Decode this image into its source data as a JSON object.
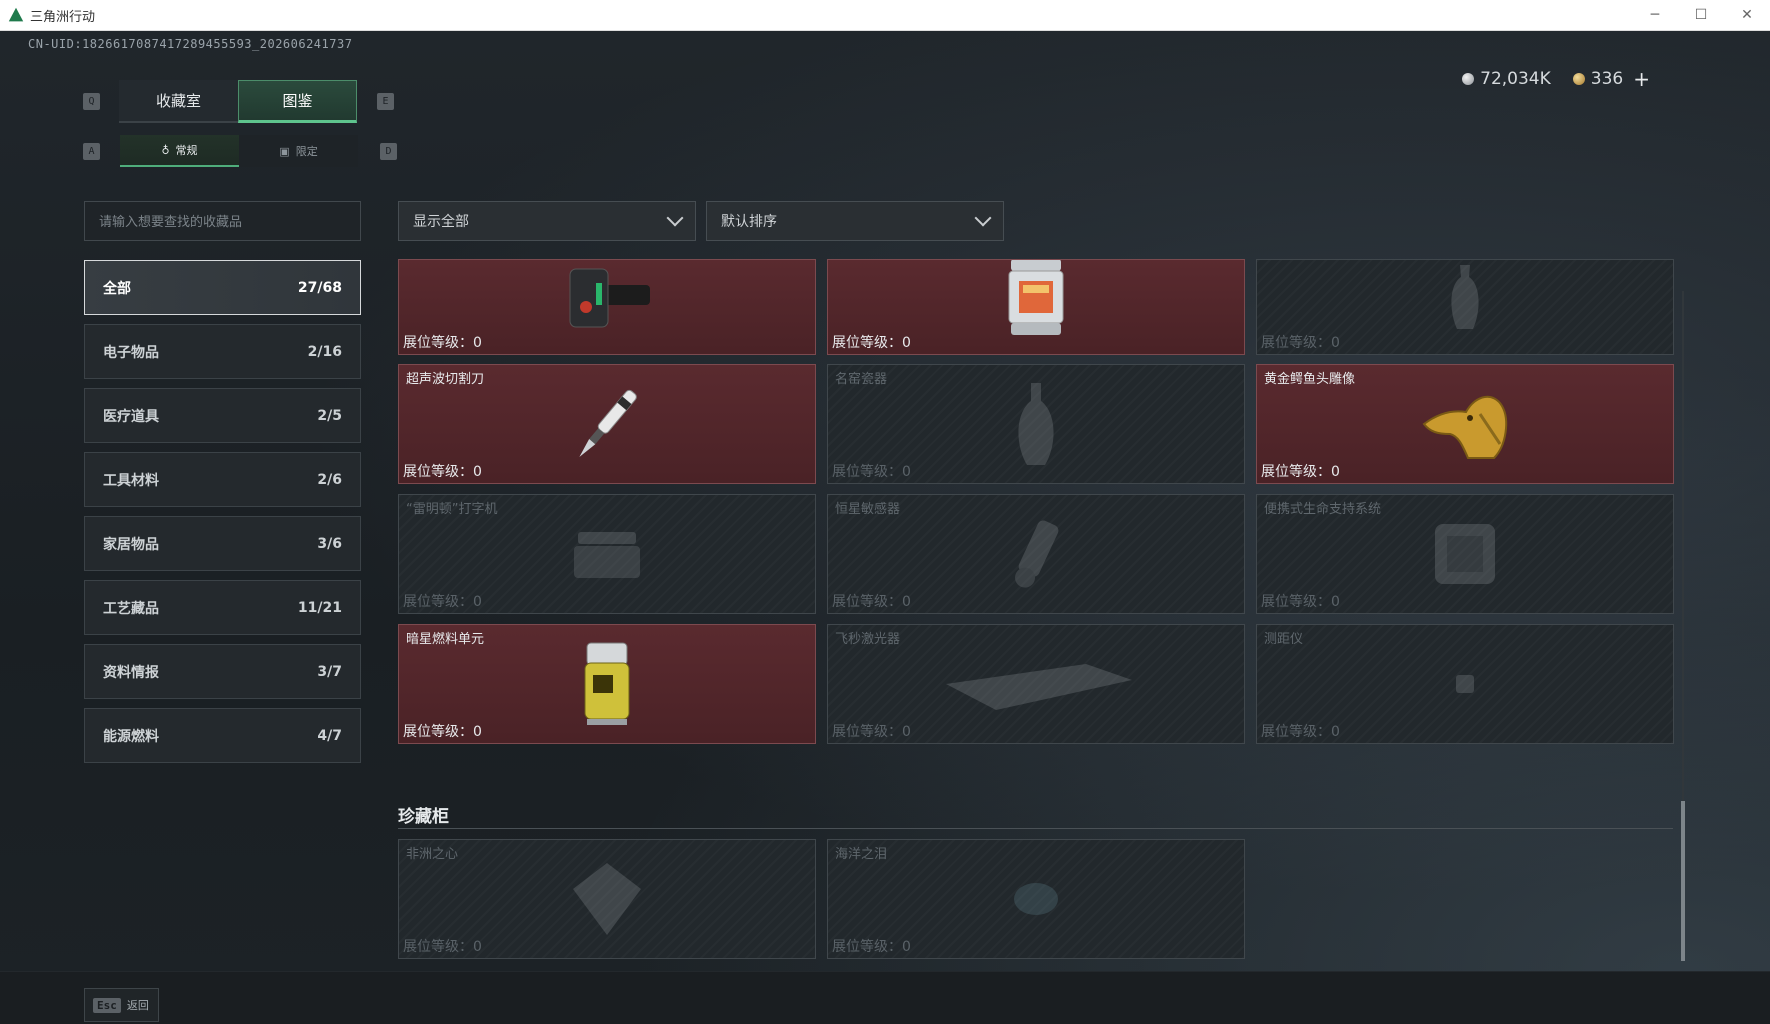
{
  "window": {
    "title": "三角洲行动",
    "minimize": "─",
    "maximize": "☐",
    "close": "✕"
  },
  "header": {
    "uid": "CN-UID:1826617087417289455593_202606241737",
    "currency": [
      {
        "icon": "silver-coin-icon",
        "value": "72,034K"
      },
      {
        "icon": "gold-coin-icon",
        "value": "336"
      }
    ],
    "plus_label": "+"
  },
  "tabs": {
    "prev_key": "Q",
    "next_key": "E",
    "main": [
      {
        "label": "收藏室",
        "active": false
      },
      {
        "label": "图鉴",
        "active": true
      }
    ],
    "sub_prev_key": "A",
    "sub_next_key": "D",
    "sub": [
      {
        "label": "常规",
        "active": true
      },
      {
        "label": "限定",
        "active": false
      }
    ]
  },
  "search": {
    "placeholder": "请输入想要查找的收藏品"
  },
  "categories": [
    {
      "label": "全部",
      "count": "27/68",
      "active": true
    },
    {
      "label": "电子物品",
      "count": "2/16"
    },
    {
      "label": "医疗道具",
      "count": "2/5"
    },
    {
      "label": "工具材料",
      "count": "2/6"
    },
    {
      "label": "家居物品",
      "count": "3/6"
    },
    {
      "label": "工艺藏品",
      "count": "11/21"
    },
    {
      "label": "资料情报",
      "count": "3/7"
    },
    {
      "label": "能源燃料",
      "count": "4/7"
    }
  ],
  "filters": {
    "show": "显示全部",
    "sort": "默认排序"
  },
  "level_label": "展位等级：0",
  "items": [
    {
      "name": "",
      "owned": true,
      "art": "wrist-device-icon"
    },
    {
      "name": "",
      "owned": true,
      "art": "lantern-icon"
    },
    {
      "name": "",
      "owned": false,
      "art": "vase-icon"
    },
    {
      "name": "超声波切割刀",
      "owned": true,
      "art": "cutter-knife-icon"
    },
    {
      "name": "名窑瓷器",
      "owned": false,
      "art": "porcelain-icon"
    },
    {
      "name": "黄金鳄鱼头雕像",
      "owned": true,
      "art": "gold-crocodile-icon"
    },
    {
      "name": "“雷明顿”打字机",
      "owned": false,
      "art": "typewriter-icon"
    },
    {
      "name": "恒星敏感器",
      "owned": false,
      "art": "sensor-icon"
    },
    {
      "name": "便携式生命支持系统",
      "owned": false,
      "art": "life-support-icon"
    },
    {
      "name": "暗星燃料单元",
      "owned": true,
      "art": "fuel-cell-icon"
    },
    {
      "name": "飞秒激光器",
      "owned": false,
      "art": "laser-icon"
    },
    {
      "name": "测距仪",
      "owned": false,
      "art": "rangefinder-icon"
    }
  ],
  "treasure_section": {
    "title": "珍藏柜",
    "items": [
      {
        "name": "非洲之心",
        "owned": false,
        "art": "diamond-icon"
      },
      {
        "name": "海洋之泪",
        "owned": false,
        "art": "gem-icon"
      }
    ]
  },
  "footer": {
    "esc_key": "Esc",
    "back_label": "返回"
  }
}
